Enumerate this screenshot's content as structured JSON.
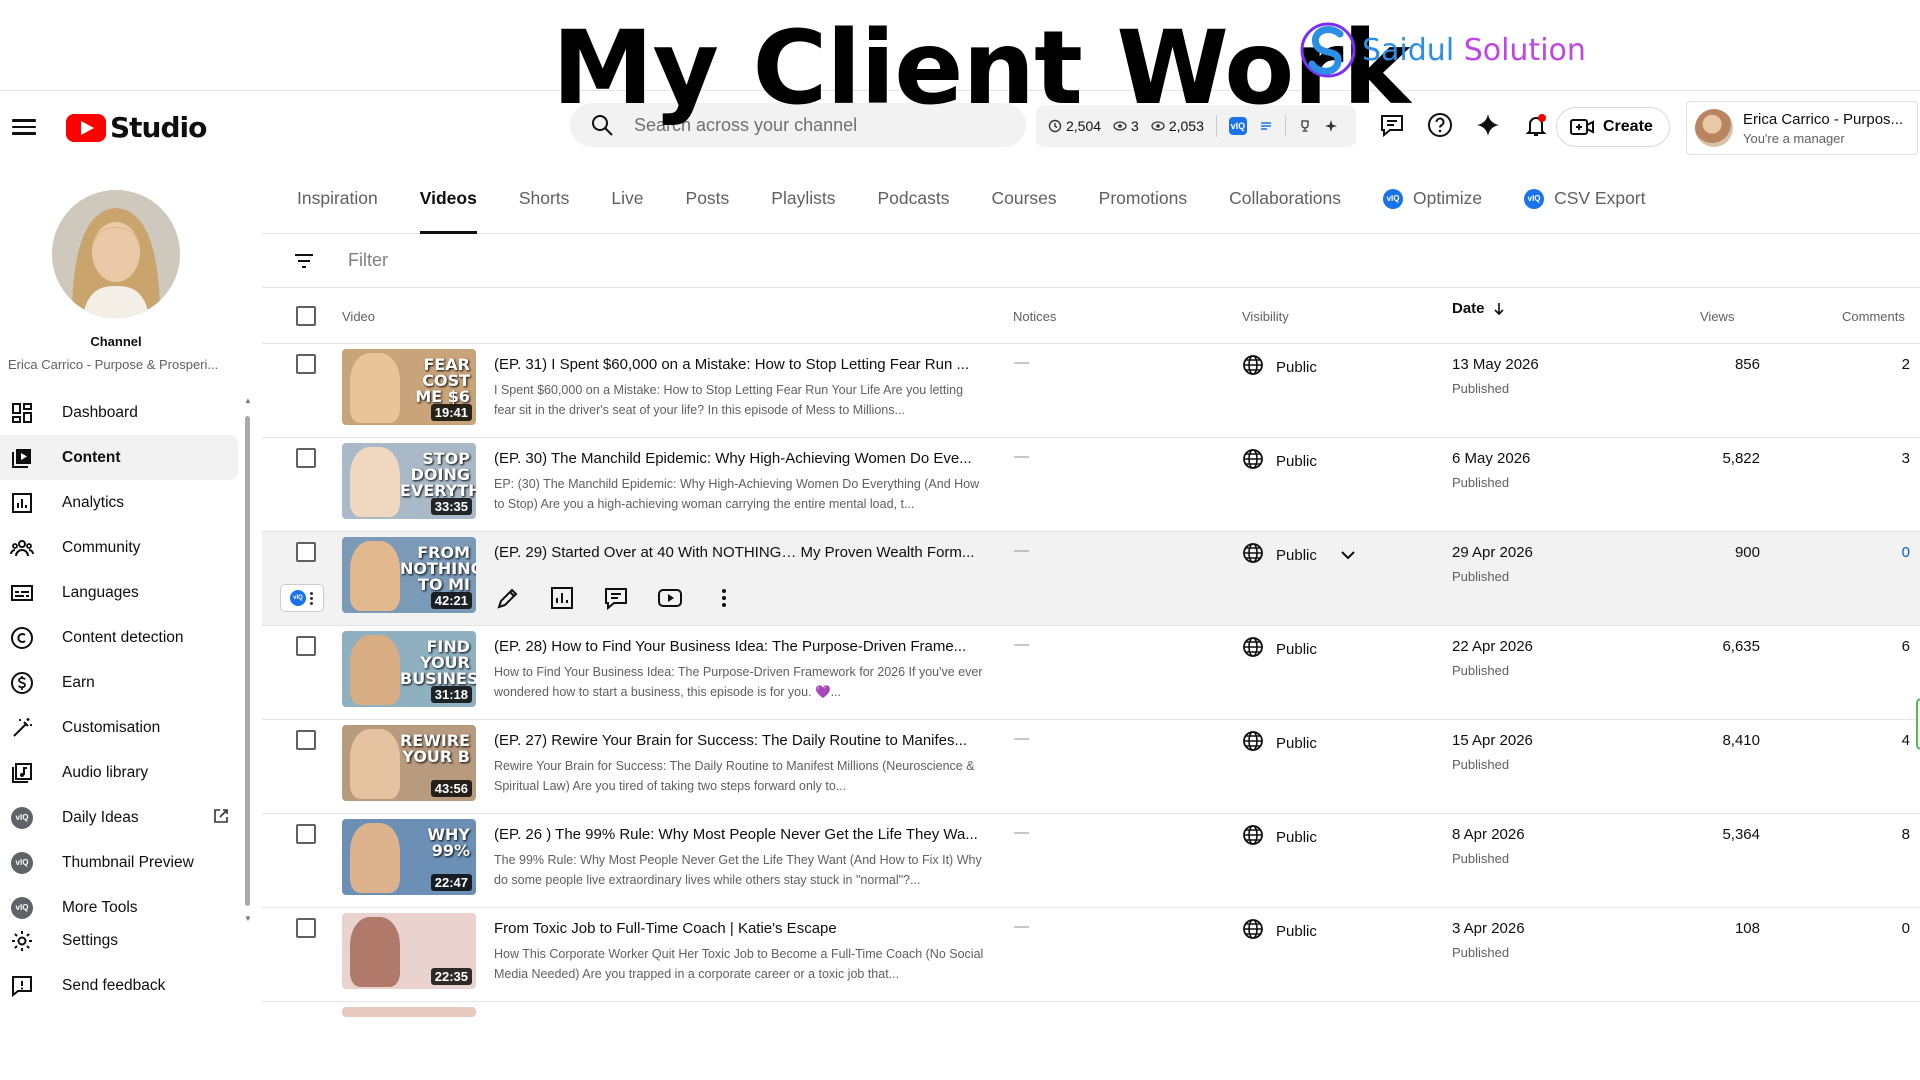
{
  "banner": {
    "title": "My Client Work",
    "brand_part1": "Saidul ",
    "brand_part2": "Solution"
  },
  "header": {
    "studio_label": "Studio",
    "search_placeholder": "Search across your channel",
    "stats": {
      "watch_hours": "2,504",
      "subs_change": "3",
      "views": "2,053"
    },
    "create_label": "Create",
    "account_name": "Erica Carrico - Purpos...",
    "account_role": "You're a manager"
  },
  "sidebar": {
    "channel_label": "Channel",
    "channel_name": "Erica Carrico - Purpose & Prosperi...",
    "items": [
      {
        "label": "Dashboard",
        "icon": "dashboard-icon"
      },
      {
        "label": "Content",
        "icon": "content-icon",
        "active": true
      },
      {
        "label": "Analytics",
        "icon": "analytics-icon"
      },
      {
        "label": "Community",
        "icon": "community-icon"
      },
      {
        "label": "Languages",
        "icon": "subtitles-icon"
      },
      {
        "label": "Content detection",
        "icon": "copyright-icon"
      },
      {
        "label": "Earn",
        "icon": "dollar-icon"
      },
      {
        "label": "Customisation",
        "icon": "magic-wand-icon"
      },
      {
        "label": "Audio library",
        "icon": "audio-library-icon"
      },
      {
        "label": "Daily Ideas",
        "icon": "vidiq-icon"
      },
      {
        "label": "Thumbnail Preview",
        "icon": "vidiq-icon"
      },
      {
        "label": "More Tools",
        "icon": "vidiq-icon"
      },
      {
        "label": "Settings",
        "icon": "gear-icon"
      },
      {
        "label": "Send feedback",
        "icon": "feedback-icon"
      }
    ],
    "vidiq_badge": "vIQ"
  },
  "tabs": [
    {
      "label": "Inspiration"
    },
    {
      "label": "Videos",
      "active": true
    },
    {
      "label": "Shorts"
    },
    {
      "label": "Live"
    },
    {
      "label": "Posts"
    },
    {
      "label": "Playlists"
    },
    {
      "label": "Podcasts"
    },
    {
      "label": "Courses"
    },
    {
      "label": "Promotions"
    },
    {
      "label": "Collaborations"
    },
    {
      "label": "Optimize",
      "vidiq": true
    },
    {
      "label": "CSV Export",
      "vidiq": true
    }
  ],
  "filter_placeholder": "Filter",
  "columns": {
    "video": "Video",
    "notices": "Notices",
    "visibility": "Visibility",
    "date": "Date",
    "views": "Views",
    "comments": "Comments"
  },
  "videos": [
    {
      "title": "(EP. 31) I Spent $60,000 on a Mistake: How to Stop Letting Fear Run ...",
      "desc": "I Spent $60,000 on a Mistake: How to Stop Letting Fear Run Your Life Are you letting fear sit in the driver's seat of your life? In this episode of Mess to Millions...",
      "duration": "19:41",
      "thumb_text": "FEAR COST ME $6",
      "notice": "—",
      "visibility": "Public",
      "date": "13 May 2026",
      "status": "Published",
      "views": "856",
      "comments": "2",
      "bg": "#c9a47a",
      "face": "#e8c49a"
    },
    {
      "title": "(EP. 30) The Manchild Epidemic: Why High-Achieving Women Do Eve...",
      "desc": "EP: (30) The Manchild Epidemic: Why High-Achieving Women Do Everything (And How to Stop) Are you a high-achieving woman carrying the entire mental load, t...",
      "duration": "33:35",
      "thumb_text": "STOP DOING EVERYTHING",
      "notice": "—",
      "visibility": "Public",
      "date": "6 May 2026",
      "status": "Published",
      "views": "5,822",
      "comments": "3",
      "bg": "#a9b9c8",
      "face": "#f0d8c0"
    },
    {
      "title": "(EP. 29) Started Over at 40 With NOTHING… My Proven Wealth Form...",
      "desc": "",
      "duration": "42:21",
      "thumb_text": "FROM NOTHING TO MI",
      "notice": "—",
      "visibility": "Public",
      "date": "29 Apr 2026",
      "status": "Published",
      "views": "900",
      "comments": "0",
      "bg": "#7a9ab8",
      "face": "#e2b98e",
      "hover": true
    },
    {
      "title": "(EP. 28) How to Find Your Business Idea: The Purpose-Driven Frame...",
      "desc": "How to Find Your Business Idea: The Purpose-Driven Framework for 2026 If you've ever wondered how to start a business, this episode is for you. 💜...",
      "duration": "31:18",
      "thumb_text": "FIND YOUR BUSINESS",
      "notice": "—",
      "visibility": "Public",
      "date": "22 Apr 2026",
      "status": "Published",
      "views": "6,635",
      "comments": "6",
      "bg": "#8eb0c0",
      "face": "#d8ad84"
    },
    {
      "title": "(EP. 27) Rewire Your Brain for Success: The Daily Routine to Manifes...",
      "desc": "Rewire Your Brain for Success: The Daily Routine to Manifest Millions (Neuroscience & Spiritual Law) Are you tired of taking two steps forward only to...",
      "duration": "43:56",
      "thumb_text": "REWIRE YOUR B",
      "notice": "—",
      "visibility": "Public",
      "date": "15 Apr 2026",
      "status": "Published",
      "views": "8,410",
      "comments": "4",
      "bg": "#b89a7e",
      "face": "#e6c3a0"
    },
    {
      "title": "(EP. 26 ) The 99% Rule: Why Most People Never Get the Life They Wa...",
      "desc": "The 99% Rule: Why Most People Never Get the Life They Want (And How to Fix It) Why do some people live extraordinary lives while others stay stuck in \"normal\"?...",
      "duration": "22:47",
      "thumb_text": "WHY 99%",
      "notice": "—",
      "visibility": "Public",
      "date": "8 Apr 2026",
      "status": "Published",
      "views": "5,364",
      "comments": "8",
      "bg": "#6b8fb5",
      "face": "#dcb38c"
    },
    {
      "title": "From Toxic Job to Full-Time Coach | Katie's Escape",
      "desc": "How This Corporate Worker Quit Her Toxic Job to Become a Full-Time Coach (No Social Media Needed) Are you trapped in a corporate career or a toxic job that...",
      "duration": "22:35",
      "thumb_text": "",
      "notice": "—",
      "visibility": "Public",
      "date": "3 Apr 2026",
      "status": "Published",
      "views": "108",
      "comments": "0",
      "bg": "#ead3cf",
      "face": "#b0796a"
    }
  ],
  "colors": {
    "youtube_red": "#ff0000",
    "vidiq_blue": "#1a73e8",
    "link_blue": "#065fd4"
  }
}
